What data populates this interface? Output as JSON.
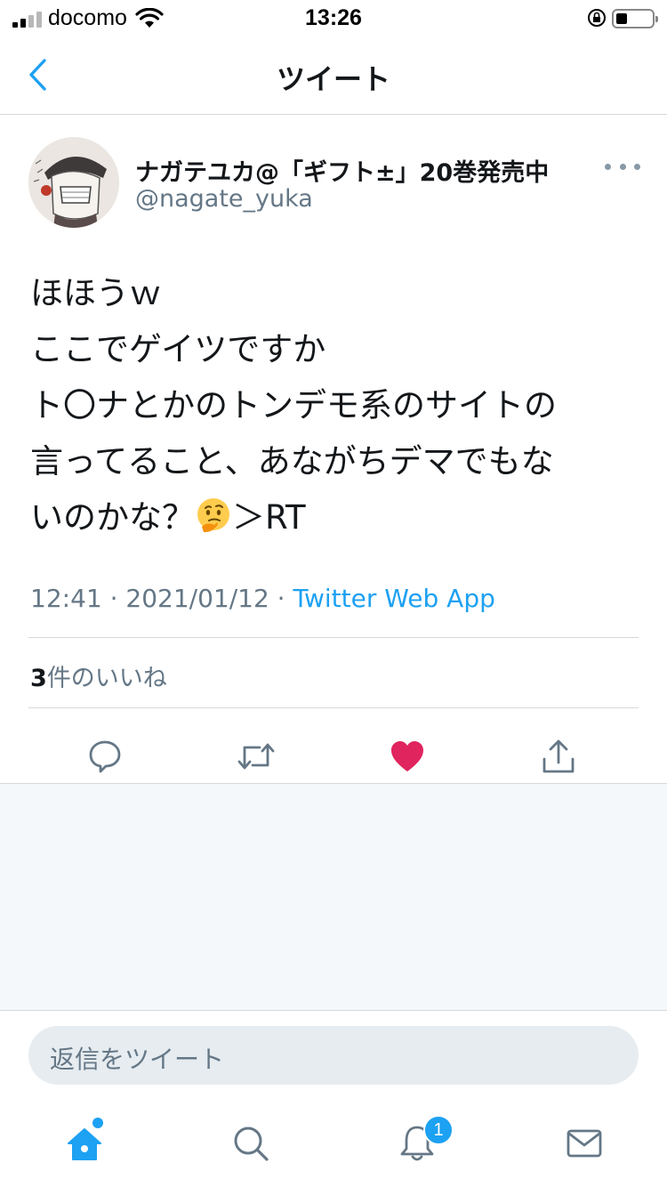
{
  "status_bar": {
    "carrier": "docomo",
    "time": "13:26"
  },
  "nav": {
    "title": "ツイート"
  },
  "tweet": {
    "author_name": "ナガテユカ@「ギフト±」20巻発売中",
    "author_handle": "@nagate_yuka",
    "body_lines": [
      "ほほうｗ",
      "ここでゲイツですか",
      "ト〇ナとかのトンデモ系のサイトの",
      "言ってること、あながちデマでもな",
      "いのかな？",
      "＞RT"
    ],
    "timestamp": "12:41 · 2021/01/12 · ",
    "source": "Twitter Web App",
    "likes_count": "3",
    "likes_label": "件のいいね"
  },
  "reply": {
    "placeholder": "返信をツイート"
  },
  "tabs": {
    "notifications_badge": "1"
  },
  "colors": {
    "accent": "#1da1f2",
    "like": "#e0245e",
    "muted": "#657786"
  },
  "icons": [
    "back-chevron-icon",
    "more-dots-icon",
    "reply-icon",
    "retweet-icon",
    "like-heart-icon",
    "share-icon",
    "home-icon",
    "search-icon",
    "notifications-bell-icon",
    "messages-envelope-icon"
  ]
}
